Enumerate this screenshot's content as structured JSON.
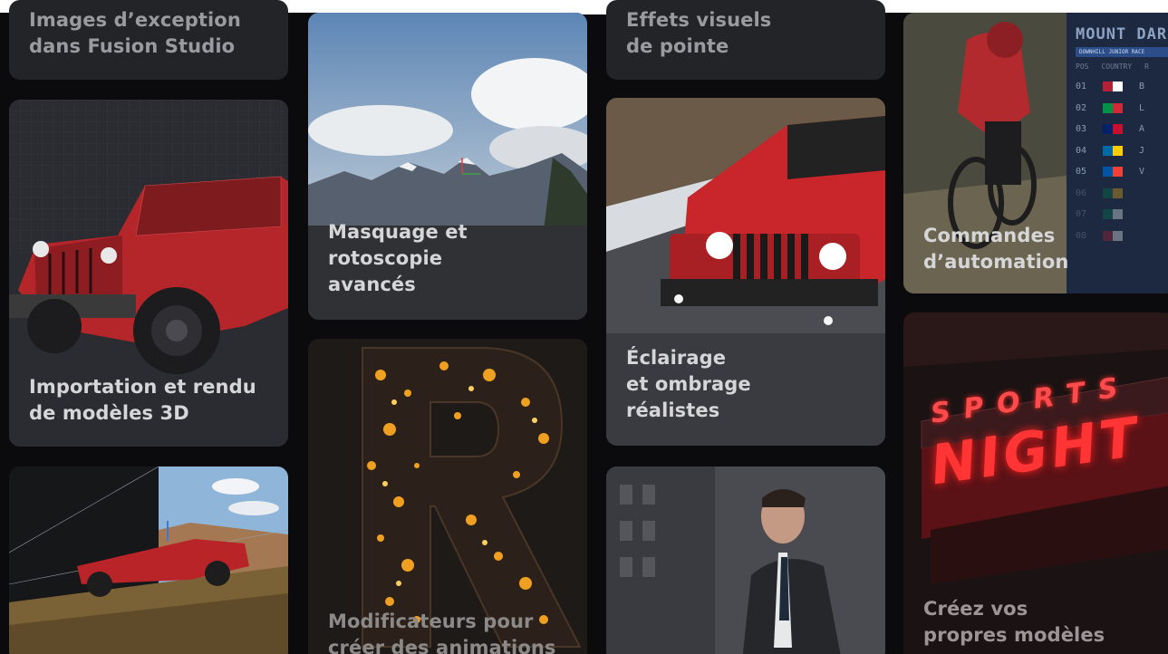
{
  "cards": {
    "fusion_images": {
      "title": "Images d’exception\ndans Fusion Studio"
    },
    "models_3d": {
      "title": "Importation et rendu\nde modèles 3D"
    },
    "camera_tracking": {
      "title": ""
    },
    "masking": {
      "title": "Masquage et\nrotoscopie\navancés"
    },
    "modifiers": {
      "title": "Modificateurs pour\ncréer des animations"
    },
    "visual_effects": {
      "title": "Effets visuels\nde pointe"
    },
    "lighting": {
      "title": "Éclairage\net ombrage\nréalistes"
    },
    "portrait": {
      "title": ""
    },
    "automation": {
      "title": "Commandes\nd’automation",
      "leaderboard": {
        "header": "MOUNT DAR",
        "subheader": "DOWNHILL JUNIOR RACE",
        "columns": [
          "POS",
          "COUNTRY",
          "R"
        ],
        "rows": [
          {
            "pos": "01",
            "initial": "B"
          },
          {
            "pos": "02",
            "initial": "L"
          },
          {
            "pos": "03",
            "initial": "A"
          },
          {
            "pos": "04",
            "initial": "J"
          },
          {
            "pos": "05",
            "initial": "V"
          },
          {
            "pos": "06",
            "initial": ""
          },
          {
            "pos": "07",
            "initial": ""
          },
          {
            "pos": "08",
            "initial": ""
          }
        ]
      }
    },
    "templates": {
      "title": "Créez vos\npropres modèles",
      "sign_top": "SPORTS",
      "sign_bottom": "NIGHT"
    }
  },
  "colors": {
    "page_bg": "#0b0b0d",
    "card_bg": "#2b2c31",
    "label_text": "#d6d6d8",
    "jeep_red": "#c8262b",
    "neon_red": "#ff2b2b"
  }
}
